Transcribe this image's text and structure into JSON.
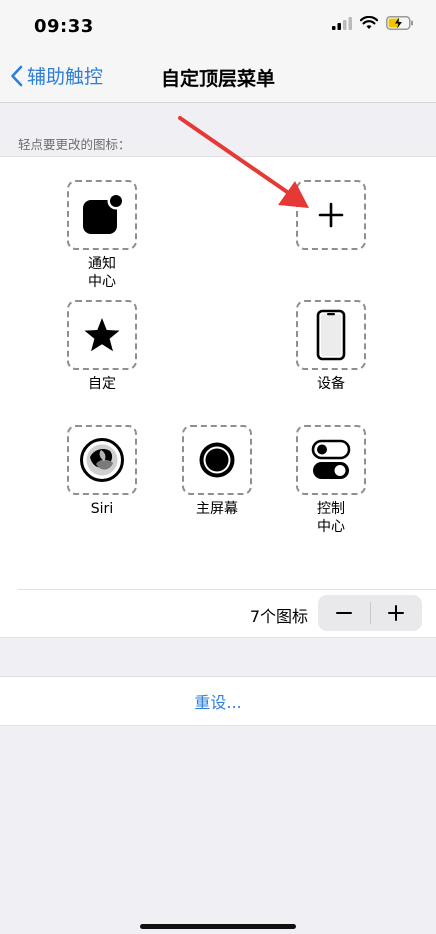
{
  "status_bar": {
    "time": "09:33"
  },
  "nav": {
    "back_label": "辅助触控",
    "title": "自定顶层菜单"
  },
  "section_hint": "轻点要更改的图标：",
  "slots": {
    "notification": {
      "label_line1": "通知",
      "label_line2": "中心",
      "icon": "notification-center-icon"
    },
    "add": {
      "icon": "plus-icon"
    },
    "custom": {
      "label": "自定",
      "icon": "star-icon"
    },
    "device": {
      "label": "设备",
      "icon": "iphone-icon"
    },
    "siri": {
      "label": "Siri",
      "icon": "siri-icon"
    },
    "home": {
      "label": "主屏幕",
      "icon": "home-button-icon"
    },
    "control": {
      "label_line1": "控制",
      "label_line2": "中心",
      "icon": "control-center-icon"
    }
  },
  "icon_count_text": "7个图标",
  "stepper": {
    "minus": "−",
    "plus": "+"
  },
  "reset_label": "重设...",
  "colors": {
    "accent": "#2f7fd9",
    "annotation_arrow": "#e53935",
    "background": "#efeff4"
  }
}
